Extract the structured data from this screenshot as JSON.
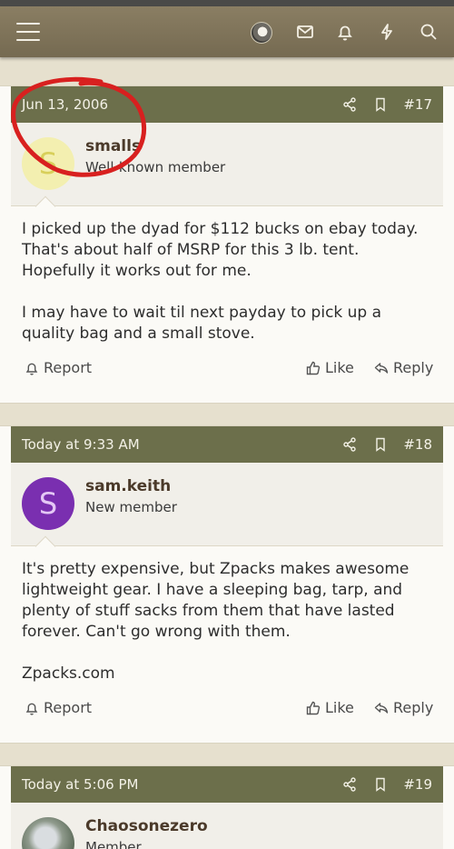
{
  "nav": {
    "icons": [
      "menu-icon",
      "avatar",
      "mail-icon",
      "bell-icon",
      "lightning-icon",
      "search-icon"
    ]
  },
  "posts": [
    {
      "date": "Jun 13, 2006",
      "number": "#17",
      "username": "smalls",
      "user_title": "Well-known member",
      "avatar_letter": "S",
      "avatar_bg": "#f3efb0",
      "avatar_fg": "#d8cf5a",
      "paragraphs": [
        "I picked up the dyad for $112 bucks on ebay today. That's about half of MSRP for this 3 lb. tent. Hopefully it works out for me.",
        "I may have to wait til next payday to pick up a quality bag and a small stove."
      ],
      "actions": {
        "report": "Report",
        "like": "Like",
        "reply": "Reply"
      }
    },
    {
      "date": "Today at 9:33 AM",
      "number": "#18",
      "username": "sam.keith",
      "user_title": "New member",
      "avatar_letter": "S",
      "avatar_bg": "#7a2fb0",
      "avatar_fg": "#e4c8f5",
      "paragraphs": [
        "It's pretty expensive, but Zpacks makes awesome lightweight gear. I have a sleeping bag, tarp, and plenty of stuff sacks from them that have lasted forever. Can't go wrong with them.",
        "Zpacks.com"
      ],
      "actions": {
        "report": "Report",
        "like": "Like",
        "reply": "Reply"
      }
    },
    {
      "date": "Today at 5:06 PM",
      "number": "#19",
      "username": "Chaosonezero",
      "user_title": "Member"
    }
  ],
  "colors": {
    "header_bar": "#6c6f4b",
    "nav_bar": "#7f7458",
    "annotation": "#d8201f"
  }
}
